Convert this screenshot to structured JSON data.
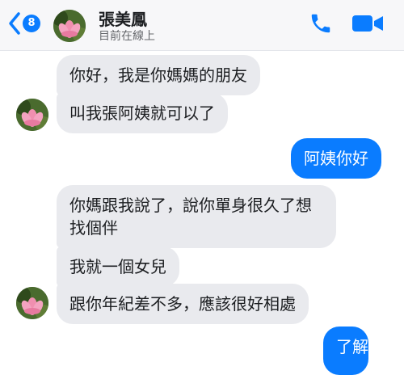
{
  "header": {
    "unread_count": "8",
    "contact_name": "張美鳳",
    "status": "目前在線上"
  },
  "messages": [
    {
      "from": "contact",
      "text": "你好，我是你媽媽的朋友"
    },
    {
      "from": "contact",
      "text": "叫我張阿姨就可以了"
    },
    {
      "from": "me",
      "text": "阿姨你好"
    },
    {
      "from": "contact",
      "text": "你媽跟我說了，說你單身很久了想找個伴"
    },
    {
      "from": "contact",
      "text": "我就一個女兒"
    },
    {
      "from": "contact",
      "text": "跟你年紀差不多，應該很好相處"
    },
    {
      "from": "me",
      "text": "了解"
    }
  ],
  "colors": {
    "accent": "#0a7cff",
    "incoming_bubble": "#e9eaee",
    "header_bg": "#f7f7f9"
  },
  "icons": [
    "back-chevron-icon",
    "phone-icon",
    "video-camera-icon",
    "lotus-avatar"
  ]
}
